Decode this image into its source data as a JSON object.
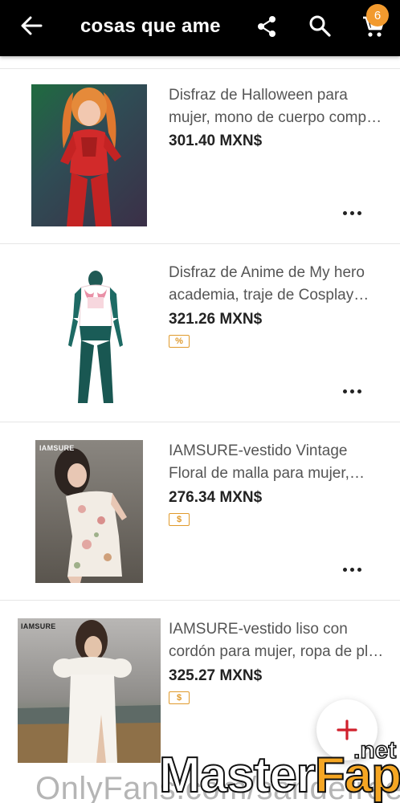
{
  "appbar": {
    "title": "cosas que ame",
    "cart_count": "6"
  },
  "items": [
    {
      "title": "Disfraz de Halloween para mujer, mono de cuerpo comp…",
      "price": "301.40 MXN$",
      "badge": ""
    },
    {
      "title": "Disfraz de Anime de My hero academia, traje de Cosplay de…",
      "price": "321.26 MXN$",
      "badge": "%"
    },
    {
      "title": "IAMSURE-vestido Vintage Floral de malla para mujer, minives…",
      "price": "276.34 MXN$",
      "badge": "$",
      "brand": "IAMSURE"
    },
    {
      "title": "IAMSURE-vestido liso con cordón para mujer, ropa de pl…",
      "price": "325.27 MXN$",
      "badge": "$",
      "brand": "IAMSURE"
    }
  ],
  "watermark": {
    "left": "OnlyFans.com/sandefree",
    "right_a": "Master",
    "right_b": "Fap",
    "net": ".net"
  },
  "colors": {
    "appbar": "#000000",
    "badge": "#f29a2e",
    "coupon": "#e09a2c",
    "fab_plus": "#d0202c"
  }
}
